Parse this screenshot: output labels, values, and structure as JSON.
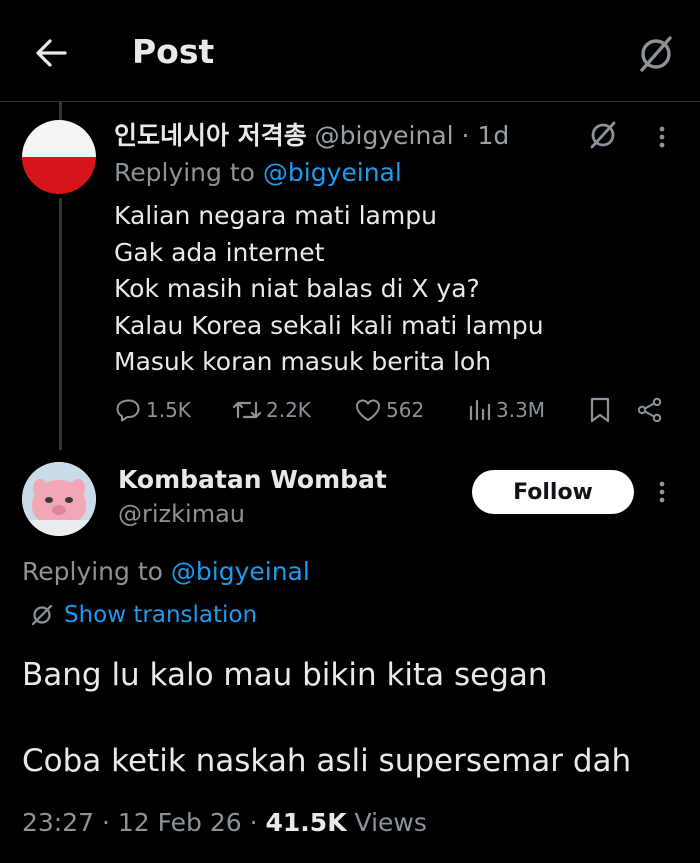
{
  "header": {
    "title": "Post"
  },
  "reply_tweet": {
    "display_name": "인도네시아 저격총",
    "handle": "@bigyeinal",
    "time": "· 1d",
    "replying_prefix": "Replying to ",
    "replying_handle": "@bigyeinal",
    "lines": [
      "Kalian negara mati lampu",
      "Gak ada internet",
      "Kok masih niat balas di X ya?",
      "Kalau Korea sekali kali mati lampu",
      "Masuk koran masuk berita loh"
    ],
    "actions": {
      "replies": "1.5K",
      "reposts": "2.2K",
      "likes": "562",
      "views": "3.3M"
    }
  },
  "main_tweet": {
    "display_name": "Kombatan Wombat",
    "handle": "@rizkimau",
    "follow_label": "Follow",
    "replying_prefix": "Replying to ",
    "replying_handle": "@bigyeinal",
    "show_translation": "Show translation",
    "line1": "Bang lu kalo mau bikin kita segan",
    "line2": "Coba ketik naskah asli supersemar dah",
    "time": "23:27 · 12 Feb 26 · ",
    "views_count": "41.5K",
    "views_label": " Views"
  },
  "icons": [
    "back-arrow-icon",
    "grok-icon",
    "more-icon",
    "reply-icon",
    "repost-icon",
    "like-icon",
    "views-icon",
    "bookmark-icon",
    "share-icon",
    "translate-icon"
  ]
}
